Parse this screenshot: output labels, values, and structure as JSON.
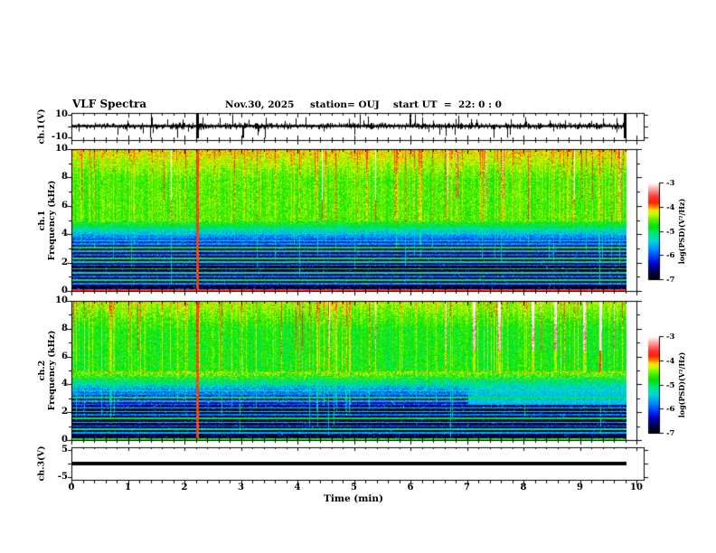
{
  "header": {
    "title": "VLF Spectra",
    "date": "Nov.30, 2025",
    "station": "station= OUJ",
    "start_ut": "start UT  =  22: 0 : 0"
  },
  "axes": {
    "x": {
      "label": "Time (min)",
      "range": [
        0,
        10
      ],
      "major_ticks": [
        0,
        1,
        2,
        3,
        4,
        5,
        6,
        7,
        8,
        9,
        10
      ],
      "minor_step": 0.2,
      "data_end_min": 9.82
    }
  },
  "colormap": {
    "range": [
      -7,
      -3
    ],
    "stops": [
      [
        0.0,
        "#000000"
      ],
      [
        0.08,
        "#00004a"
      ],
      [
        0.16,
        "#0000c8"
      ],
      [
        0.24,
        "#0040ff"
      ],
      [
        0.32,
        "#0090ff"
      ],
      [
        0.4,
        "#00d8d8"
      ],
      [
        0.48,
        "#00e87a"
      ],
      [
        0.55,
        "#00e000"
      ],
      [
        0.62,
        "#58f000"
      ],
      [
        0.68,
        "#c8ff00"
      ],
      [
        0.72,
        "#ffe000"
      ],
      [
        0.76,
        "#ff7000"
      ],
      [
        0.8,
        "#ff2000"
      ],
      [
        0.86,
        "#ff3838"
      ],
      [
        0.92,
        "#ff9090"
      ],
      [
        1.0,
        "#ffffff"
      ]
    ]
  },
  "chart_data": [
    {
      "id": "ch1_waveform",
      "type": "line",
      "ylabel": "ch.1(V)",
      "ylim": [
        -10,
        10
      ],
      "yticks": [
        10,
        -10
      ],
      "description": "broadband noise ~1.5 V rms around 0 V with impulsive spikes; largest spikes near 2.2 min and end of record",
      "spike_times": [
        2.21,
        9.78
      ],
      "seed": 11
    },
    {
      "id": "ch1_spectrogram",
      "type": "heatmap",
      "ylabel_line1": "ch.1",
      "ylabel_line2": "Frequency (kHz)",
      "ylim": [
        0,
        10
      ],
      "yticks": [
        10,
        8,
        6,
        4,
        2,
        0
      ],
      "value_range": [
        -7,
        -3
      ],
      "colorbar": {
        "label": "log(PSD)(V²/Hz)",
        "ticks": [
          -3,
          -4,
          -5,
          -6,
          -7
        ]
      },
      "features": {
        "upper_band": "green/yellow sferic noise 5-10 kHz with red impulsive streaks",
        "lower_band": "dark (-6.8) below 3 kHz with narrowband hum lines",
        "red_bursts": [
          2.21
        ],
        "partial_bursts": [],
        "hum_lines": [
          [
            0.55,
            -5.7
          ],
          [
            0.8,
            -5.1
          ],
          [
            1.05,
            -5.9
          ],
          [
            1.3,
            -5.3
          ],
          [
            1.6,
            -4.9
          ],
          [
            1.85,
            -5.8
          ],
          [
            2.1,
            -5.4
          ],
          [
            2.35,
            -5.1
          ],
          [
            2.6,
            -5.9
          ],
          [
            2.85,
            -5.5
          ],
          [
            3.1,
            -4.95
          ],
          [
            3.35,
            -5.7
          ],
          [
            3.6,
            -5.2
          ],
          [
            3.85,
            -5.9
          ],
          [
            4.1,
            -5.4
          ],
          [
            4.35,
            -5.8
          ],
          [
            4.6,
            -5.1
          ],
          [
            4.85,
            -5.9
          ],
          [
            5.3,
            -5.9
          ],
          [
            5.9,
            -5.85
          ],
          [
            6.6,
            -5.9
          ]
        ],
        "bottom_row_value": -3.7
      },
      "upper_cool": 0,
      "mid_boost": 0,
      "band_enhancement": null,
      "top_red_prob": 0.03,
      "seed": 21
    },
    {
      "id": "ch2_spectrogram",
      "type": "heatmap",
      "ylabel_line1": "ch.2",
      "ylabel_line2": "Frequency (kHz)",
      "ylim": [
        0,
        10
      ],
      "yticks": [
        10,
        8,
        6,
        4,
        2,
        0
      ],
      "value_range": [
        -7,
        -3
      ],
      "colorbar": {
        "label": "log(PSD)(V²/Hz)",
        "ticks": [
          -3,
          -4,
          -5,
          -6,
          -7
        ]
      },
      "features": {
        "upper_band": "green/cyan sferic noise 5-10 kHz, red streaks mostly after 7 min",
        "lower_band": "dark below 2.5 kHz with narrowband hum lines",
        "red_bursts": [
          2.21
        ],
        "partial_bursts": [
          7.1,
          7.55,
          8.15,
          8.55,
          9.05,
          9.35
        ],
        "hum_lines": [
          [
            0.55,
            -5.6
          ],
          [
            0.8,
            -5.2
          ],
          [
            1.05,
            -5.9
          ],
          [
            1.3,
            -5.4
          ],
          [
            1.6,
            -5.0
          ],
          [
            1.85,
            -5.8
          ],
          [
            2.1,
            -5.3
          ],
          [
            2.35,
            -5.2
          ],
          [
            2.6,
            -5.9
          ],
          [
            2.85,
            -5.6
          ],
          [
            3.1,
            -5.0
          ],
          [
            3.35,
            -5.8
          ],
          [
            3.6,
            -5.3
          ],
          [
            3.85,
            -5.9
          ],
          [
            4.1,
            -5.5
          ],
          [
            4.35,
            -5.8
          ],
          [
            4.6,
            -5.2
          ],
          [
            4.85,
            -5.9
          ],
          [
            5.3,
            -5.9
          ],
          [
            5.9,
            -5.85
          ],
          [
            6.6,
            -5.9
          ]
        ],
        "bottom_row_value": -4.7
      },
      "upper_cool": 0.18,
      "mid_boost": 0.35,
      "band_enhancement": {
        "t_start": 7.0,
        "f_low": 2.6,
        "f_high": 4.6,
        "value": -5.5
      },
      "top_red_prob": 0.02,
      "seed": 22
    },
    {
      "id": "ch3_waveform",
      "type": "line",
      "ylabel": "ch.3(V)",
      "ylim": [
        -5,
        5
      ],
      "yticks": [
        5,
        -5
      ],
      "description": "flat trace at 0 V for full record",
      "value": 0,
      "seed": 13
    }
  ]
}
